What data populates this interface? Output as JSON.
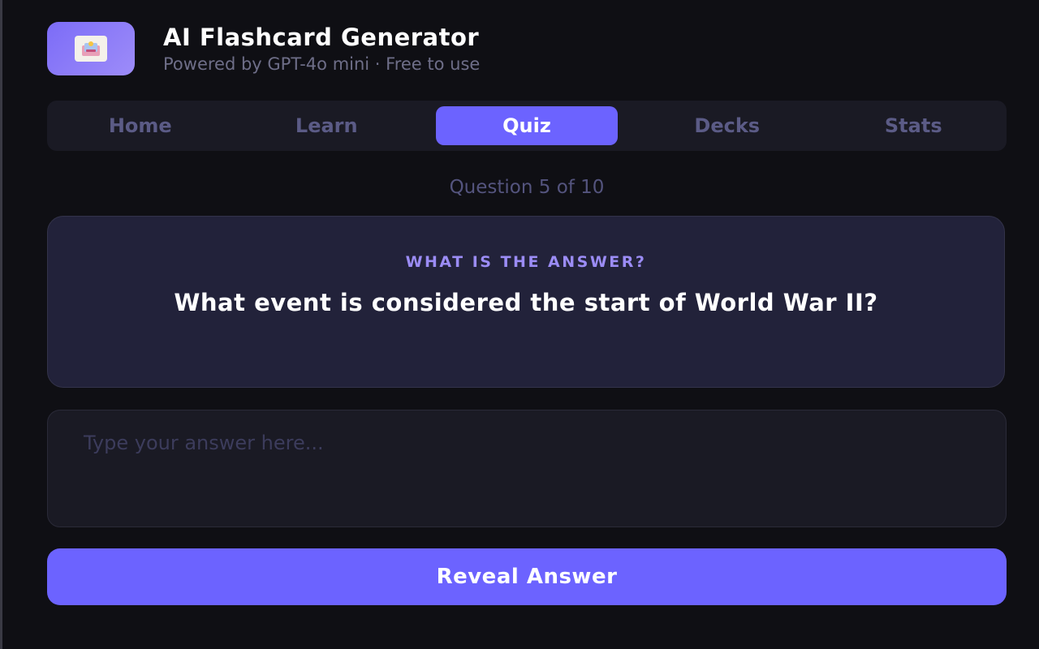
{
  "header": {
    "logo_icon": "flashcard-logo-icon",
    "title": "AI Flashcard Generator",
    "subtitle": "Powered by GPT-4o mini · Free to use"
  },
  "nav": {
    "tabs": [
      {
        "label": "Home",
        "active": false
      },
      {
        "label": "Learn",
        "active": false
      },
      {
        "label": "Quiz",
        "active": true
      },
      {
        "label": "Decks",
        "active": false
      },
      {
        "label": "Stats",
        "active": false
      }
    ]
  },
  "quiz": {
    "progress": "Question 5 of 10",
    "card_label": "WHAT IS THE ANSWER?",
    "question": "What event is considered the start of World War II?",
    "answer_value": "",
    "answer_placeholder": "Type your answer here...",
    "reveal_label": "Reveal Answer"
  },
  "colors": {
    "accent": "#6c63ff",
    "background": "#0f0f14",
    "card": "#22223a",
    "label": "#9b8cf5"
  }
}
